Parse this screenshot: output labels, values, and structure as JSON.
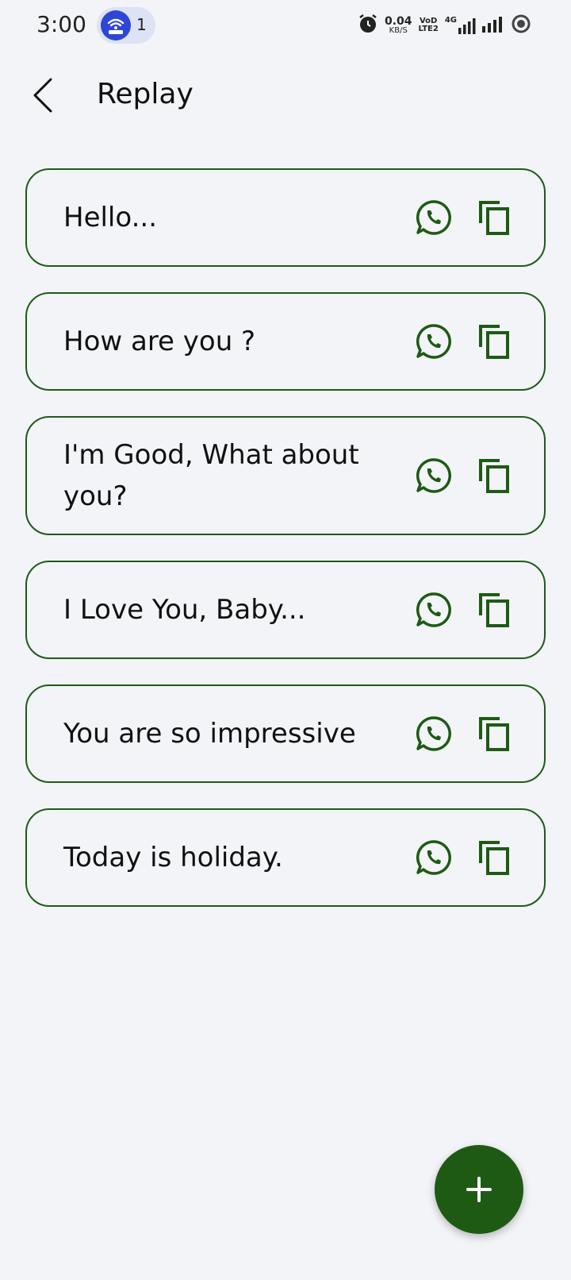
{
  "status_bar": {
    "time": "3:00",
    "hotspot_count": "1",
    "net_speed_value": "0.04",
    "net_speed_unit": "KB/S",
    "volte_label_top": "VoD",
    "volte_label_bottom": "LTE2",
    "network_type": "4G"
  },
  "app_bar": {
    "title": "Replay"
  },
  "replies": [
    {
      "text": "Hello..."
    },
    {
      "text": "How are you ?"
    },
    {
      "text": "I'm Good, What about you?"
    },
    {
      "text": "I Love You, Baby..."
    },
    {
      "text": "You are so impressive"
    },
    {
      "text": "Today is holiday."
    }
  ],
  "colors": {
    "accent": "#1e5a14",
    "card_border": "#1f5a1a",
    "background": "#f2f4f7",
    "hotspot": "#2e46d6"
  },
  "icons": {
    "back": "back-arrow-icon",
    "share": "whatsapp-icon",
    "copy": "copy-icon",
    "fab": "plus-icon"
  }
}
